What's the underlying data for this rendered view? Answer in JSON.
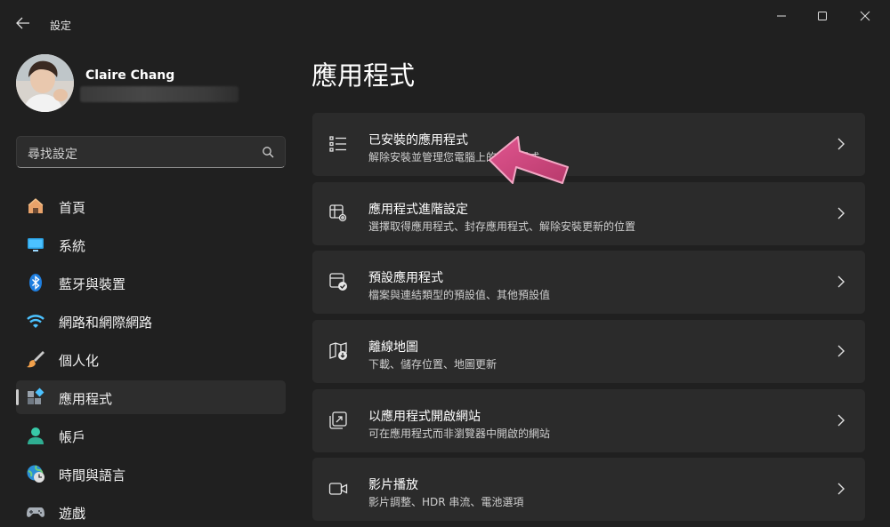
{
  "window": {
    "title": "設定"
  },
  "profile": {
    "name": "Claire Chang"
  },
  "search": {
    "placeholder": "尋找設定"
  },
  "nav": {
    "items": [
      {
        "label": "首頁",
        "icon": "home-icon"
      },
      {
        "label": "系統",
        "icon": "system-icon"
      },
      {
        "label": "藍牙與裝置",
        "icon": "bluetooth-icon"
      },
      {
        "label": "網路和網際網路",
        "icon": "wifi-icon"
      },
      {
        "label": "個人化",
        "icon": "paintbrush-icon"
      },
      {
        "label": "應用程式",
        "icon": "apps-icon",
        "active": true
      },
      {
        "label": "帳戶",
        "icon": "account-icon"
      },
      {
        "label": "時間與語言",
        "icon": "time-language-icon"
      },
      {
        "label": "遊戲",
        "icon": "gamepad-icon"
      }
    ]
  },
  "main": {
    "title": "應用程式",
    "cards": [
      {
        "title": "已安裝的應用程式",
        "desc": "解除安裝並管理您電腦上的應用程式",
        "icon": "installed-apps-icon"
      },
      {
        "title": "應用程式進階設定",
        "desc": "選擇取得應用程式、封存應用程式、解除安裝更新的位置",
        "icon": "advanced-app-settings-icon"
      },
      {
        "title": "預設應用程式",
        "desc": "檔案與連結類型的預設值、其他預設值",
        "icon": "default-apps-icon"
      },
      {
        "title": "離線地圖",
        "desc": "下載、儲存位置、地圖更新",
        "icon": "offline-maps-icon"
      },
      {
        "title": "以應用程式開啟網站",
        "desc": "可在應用程式而非瀏覽器中開啟的網站",
        "icon": "apps-for-websites-icon"
      },
      {
        "title": "影片播放",
        "desc": "影片調整、HDR 串流、電池選項",
        "icon": "video-playback-icon"
      }
    ]
  },
  "colors": {
    "background": "#202020",
    "card": "#2b2b2b",
    "annotation_arrow": "#d0447e"
  }
}
